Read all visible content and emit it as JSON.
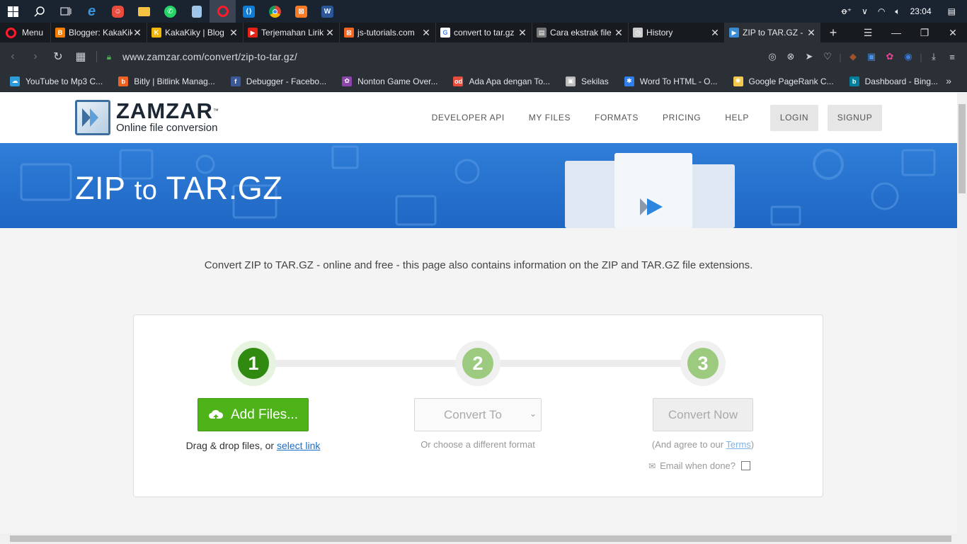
{
  "taskbar": {
    "time": "23:04",
    "apps": [
      "windows-start",
      "search",
      "task-view",
      "edge",
      "app-red",
      "file-explorer",
      "whatsapp",
      "notepad",
      "opera",
      "vscode",
      "chrome",
      "xampp",
      "word"
    ]
  },
  "tabs": {
    "menu_label": "Menu",
    "items": [
      {
        "title": "Blogger: KakaKiky",
        "fav_color": "#f57d00",
        "fav_text": "B"
      },
      {
        "title": "KakaKiky | Blog",
        "fav_color": "#f2b705",
        "fav_text": "K"
      },
      {
        "title": "Terjemahan Lirik",
        "fav_color": "#e62117",
        "fav_text": "▶"
      },
      {
        "title": "js-tutorials.com",
        "fav_color": "#f26522",
        "fav_text": "⊠"
      },
      {
        "title": "convert to tar.gz",
        "fav_color": "#ffffff",
        "fav_text": "G"
      },
      {
        "title": "Cara ekstrak file",
        "fav_color": "#777777",
        "fav_text": "▤"
      },
      {
        "title": "History",
        "fav_color": "#cccccc",
        "fav_text": "◷"
      },
      {
        "title": "ZIP to TAR.GZ - ",
        "fav_color": "#3a8bd6",
        "fav_text": "▶"
      }
    ],
    "active_index": 7
  },
  "addressbar": {
    "url": "www.zamzar.com/convert/zip-to-tar.gz/"
  },
  "bookmarks": [
    {
      "label": "YouTube to Mp3 C...",
      "fav_color": "#2d9cdb",
      "fav_text": "☁"
    },
    {
      "label": "Bitly | Bitlink Manag...",
      "fav_color": "#ee6123",
      "fav_text": "b"
    },
    {
      "label": "Debugger - Facebo...",
      "fav_color": "#3b5998",
      "fav_text": "f"
    },
    {
      "label": "Nonton Game Over...",
      "fav_color": "#8e44ad",
      "fav_text": "✿"
    },
    {
      "label": "Ada Apa dengan To...",
      "fav_color": "#e74c3c",
      "fav_text": "od"
    },
    {
      "label": "Sekilas",
      "fav_color": "#bbbbbb",
      "fav_text": "▣"
    },
    {
      "label": "Word To HTML - O...",
      "fav_color": "#2f80ed",
      "fav_text": "✱"
    },
    {
      "label": "Google PageRank C...",
      "fav_color": "#f2c94c",
      "fav_text": "✺"
    },
    {
      "label": "Dashboard - Bing...",
      "fav_color": "#00809d",
      "fav_text": "b"
    }
  ],
  "site": {
    "logo_name": "ZAMZAR",
    "logo_tm": "™",
    "logo_tagline": "Online file conversion",
    "nav": {
      "developer_api": "DEVELOPER API",
      "my_files": "MY FILES",
      "formats": "FORMATS",
      "pricing": "PRICING",
      "help": "HELP",
      "login": "LOGIN",
      "signup": "SIGNUP"
    },
    "hero_from": "ZIP",
    "hero_to_word": "to",
    "hero_target": "TAR.GZ",
    "intro": "Convert ZIP to TAR.GZ - online and free - this page also contains information on the ZIP and TAR.GZ file extensions.",
    "steps": {
      "step1": "1",
      "step2": "2",
      "step3": "3"
    },
    "add_files_label": "Add Files...",
    "drag_text": "Drag & drop files, or ",
    "select_link": "select link",
    "convert_to_placeholder": "Convert To",
    "choose_text": "Or choose a different format",
    "convert_now_label": "Convert Now",
    "agree_prefix": "(And agree to our ",
    "terms_link": "Terms",
    "agree_suffix": ")",
    "email_label": "Email when done?",
    "colors": {
      "step_active": "#2f8a0f",
      "step_inactive": "#9ccb7f",
      "add_button": "#4db319",
      "hero_blue": "#2a76d2"
    }
  }
}
